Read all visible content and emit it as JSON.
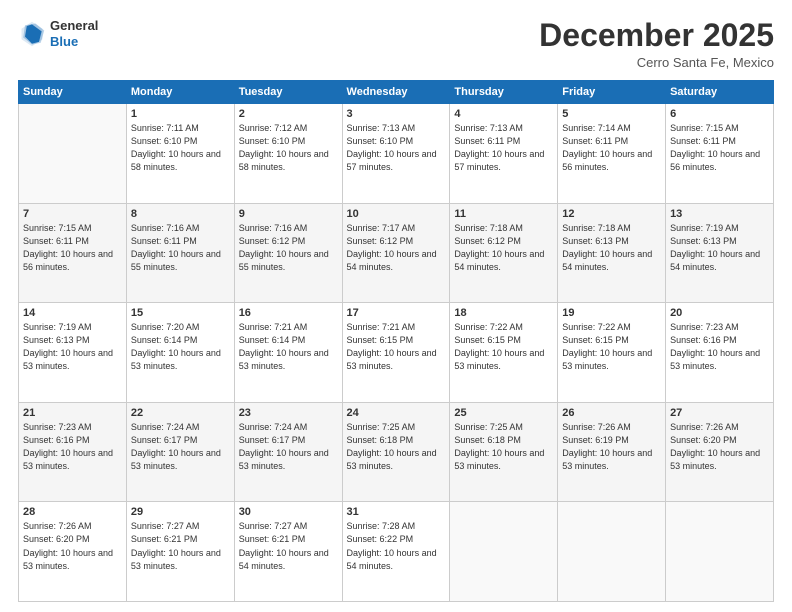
{
  "header": {
    "logo_line1": "General",
    "logo_line2": "Blue",
    "month": "December 2025",
    "location": "Cerro Santa Fe, Mexico"
  },
  "weekdays": [
    "Sunday",
    "Monday",
    "Tuesday",
    "Wednesday",
    "Thursday",
    "Friday",
    "Saturday"
  ],
  "weeks": [
    [
      {
        "day": "",
        "sunrise": "",
        "sunset": "",
        "daylight": ""
      },
      {
        "day": "1",
        "sunrise": "7:11 AM",
        "sunset": "6:10 PM",
        "daylight": "10 hours and 58 minutes."
      },
      {
        "day": "2",
        "sunrise": "7:12 AM",
        "sunset": "6:10 PM",
        "daylight": "10 hours and 58 minutes."
      },
      {
        "day": "3",
        "sunrise": "7:13 AM",
        "sunset": "6:10 PM",
        "daylight": "10 hours and 57 minutes."
      },
      {
        "day": "4",
        "sunrise": "7:13 AM",
        "sunset": "6:11 PM",
        "daylight": "10 hours and 57 minutes."
      },
      {
        "day": "5",
        "sunrise": "7:14 AM",
        "sunset": "6:11 PM",
        "daylight": "10 hours and 56 minutes."
      },
      {
        "day": "6",
        "sunrise": "7:15 AM",
        "sunset": "6:11 PM",
        "daylight": "10 hours and 56 minutes."
      }
    ],
    [
      {
        "day": "7",
        "sunrise": "7:15 AM",
        "sunset": "6:11 PM",
        "daylight": "10 hours and 56 minutes."
      },
      {
        "day": "8",
        "sunrise": "7:16 AM",
        "sunset": "6:11 PM",
        "daylight": "10 hours and 55 minutes."
      },
      {
        "day": "9",
        "sunrise": "7:16 AM",
        "sunset": "6:12 PM",
        "daylight": "10 hours and 55 minutes."
      },
      {
        "day": "10",
        "sunrise": "7:17 AM",
        "sunset": "6:12 PM",
        "daylight": "10 hours and 54 minutes."
      },
      {
        "day": "11",
        "sunrise": "7:18 AM",
        "sunset": "6:12 PM",
        "daylight": "10 hours and 54 minutes."
      },
      {
        "day": "12",
        "sunrise": "7:18 AM",
        "sunset": "6:13 PM",
        "daylight": "10 hours and 54 minutes."
      },
      {
        "day": "13",
        "sunrise": "7:19 AM",
        "sunset": "6:13 PM",
        "daylight": "10 hours and 54 minutes."
      }
    ],
    [
      {
        "day": "14",
        "sunrise": "7:19 AM",
        "sunset": "6:13 PM",
        "daylight": "10 hours and 53 minutes."
      },
      {
        "day": "15",
        "sunrise": "7:20 AM",
        "sunset": "6:14 PM",
        "daylight": "10 hours and 53 minutes."
      },
      {
        "day": "16",
        "sunrise": "7:21 AM",
        "sunset": "6:14 PM",
        "daylight": "10 hours and 53 minutes."
      },
      {
        "day": "17",
        "sunrise": "7:21 AM",
        "sunset": "6:15 PM",
        "daylight": "10 hours and 53 minutes."
      },
      {
        "day": "18",
        "sunrise": "7:22 AM",
        "sunset": "6:15 PM",
        "daylight": "10 hours and 53 minutes."
      },
      {
        "day": "19",
        "sunrise": "7:22 AM",
        "sunset": "6:15 PM",
        "daylight": "10 hours and 53 minutes."
      },
      {
        "day": "20",
        "sunrise": "7:23 AM",
        "sunset": "6:16 PM",
        "daylight": "10 hours and 53 minutes."
      }
    ],
    [
      {
        "day": "21",
        "sunrise": "7:23 AM",
        "sunset": "6:16 PM",
        "daylight": "10 hours and 53 minutes."
      },
      {
        "day": "22",
        "sunrise": "7:24 AM",
        "sunset": "6:17 PM",
        "daylight": "10 hours and 53 minutes."
      },
      {
        "day": "23",
        "sunrise": "7:24 AM",
        "sunset": "6:17 PM",
        "daylight": "10 hours and 53 minutes."
      },
      {
        "day": "24",
        "sunrise": "7:25 AM",
        "sunset": "6:18 PM",
        "daylight": "10 hours and 53 minutes."
      },
      {
        "day": "25",
        "sunrise": "7:25 AM",
        "sunset": "6:18 PM",
        "daylight": "10 hours and 53 minutes."
      },
      {
        "day": "26",
        "sunrise": "7:26 AM",
        "sunset": "6:19 PM",
        "daylight": "10 hours and 53 minutes."
      },
      {
        "day": "27",
        "sunrise": "7:26 AM",
        "sunset": "6:20 PM",
        "daylight": "10 hours and 53 minutes."
      }
    ],
    [
      {
        "day": "28",
        "sunrise": "7:26 AM",
        "sunset": "6:20 PM",
        "daylight": "10 hours and 53 minutes."
      },
      {
        "day": "29",
        "sunrise": "7:27 AM",
        "sunset": "6:21 PM",
        "daylight": "10 hours and 53 minutes."
      },
      {
        "day": "30",
        "sunrise": "7:27 AM",
        "sunset": "6:21 PM",
        "daylight": "10 hours and 54 minutes."
      },
      {
        "day": "31",
        "sunrise": "7:28 AM",
        "sunset": "6:22 PM",
        "daylight": "10 hours and 54 minutes."
      },
      {
        "day": "",
        "sunrise": "",
        "sunset": "",
        "daylight": ""
      },
      {
        "day": "",
        "sunrise": "",
        "sunset": "",
        "daylight": ""
      },
      {
        "day": "",
        "sunrise": "",
        "sunset": "",
        "daylight": ""
      }
    ]
  ]
}
